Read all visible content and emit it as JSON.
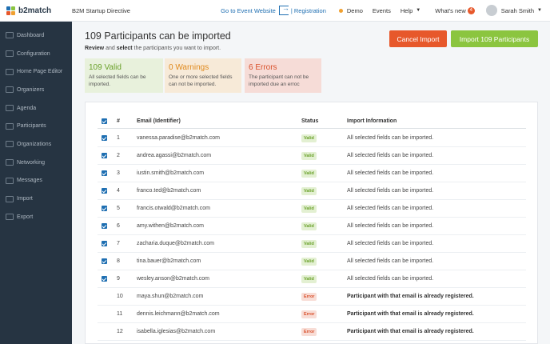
{
  "topbar": {
    "brand": "b2match",
    "event": "B2M Startup Directive",
    "links": {
      "event_website": "Go to Event Website",
      "registration": "| Registration",
      "demo": "Demo",
      "events": "Events",
      "help": "Help",
      "whats_new": "What's new",
      "whats_new_count": "4",
      "user": "Sarah Smith"
    },
    "colors": {
      "brand_blue": "#1f6fb2",
      "brand_green": "#8bc53f",
      "brand_orange": "#e7582b"
    }
  },
  "sidebar": {
    "items": [
      {
        "label": "Dashboard",
        "icon": "dashboard-icon"
      },
      {
        "label": "Configuration",
        "icon": "configuration-icon"
      },
      {
        "label": "Home Page Editor",
        "icon": "home-editor-icon"
      },
      {
        "label": "Organizers",
        "icon": "organizers-icon"
      },
      {
        "label": "Agenda",
        "icon": "agenda-icon"
      },
      {
        "label": "Participants",
        "icon": "participants-icon"
      },
      {
        "label": "Organizations",
        "icon": "organizations-icon"
      },
      {
        "label": "Networking",
        "icon": "networking-icon"
      },
      {
        "label": "Messages",
        "icon": "messages-icon"
      },
      {
        "label": "Import",
        "icon": "import-icon"
      },
      {
        "label": "Export",
        "icon": "export-icon"
      }
    ]
  },
  "main": {
    "title": "109 Participants can be imported",
    "subtitle_1": "Review",
    "subtitle_2": " and ",
    "subtitle_3": "select",
    "subtitle_4": " the participants you want to import.",
    "cancel_label": "Cancel Import",
    "import_label": "Import 109 Participants",
    "stats": {
      "valid": {
        "title": "109 Valid",
        "desc": "All selected fields can be imported."
      },
      "warnings": {
        "title": "0 Warnings",
        "desc": "One or more selected fields can not be imported."
      },
      "errors": {
        "title": "6 Errors",
        "desc": "The participant can not be imported due an erroc"
      }
    }
  },
  "table": {
    "headers": {
      "num": "#",
      "email": "Email (Identifier)",
      "status": "Status",
      "info": "Import Information"
    },
    "rows": [
      {
        "checked": true,
        "num": "1",
        "email": "vanessa.paradise@b2match.com",
        "status": "Valid",
        "info": "All selected fields can be imported."
      },
      {
        "checked": true,
        "num": "2",
        "email": "andrea.agassi@b2match.com",
        "status": "Valid",
        "info": "All selected fields can be imported."
      },
      {
        "checked": true,
        "num": "3",
        "email": "iustin.smith@b2match.com",
        "status": "Valid",
        "info": "All selected fields can be imported."
      },
      {
        "checked": true,
        "num": "4",
        "email": "franco.ted@b2match.com",
        "status": "Valid",
        "info": "All selected fields can be imported."
      },
      {
        "checked": true,
        "num": "5",
        "email": "francis.otwald@b2match.com",
        "status": "Valid",
        "info": "All selected fields can be imported."
      },
      {
        "checked": true,
        "num": "6",
        "email": "amy.withen@b2match.com",
        "status": "Valid",
        "info": "All selected fields can be imported."
      },
      {
        "checked": true,
        "num": "7",
        "email": "zacharia.duque@b2match.com",
        "status": "Valid",
        "info": "All selected fields can be imported."
      },
      {
        "checked": true,
        "num": "8",
        "email": "tina.bauer@b2match.com",
        "status": "Valid",
        "info": "All selected fields can be imported."
      },
      {
        "checked": true,
        "num": "9",
        "email": "wesley.anson@b2match.com",
        "status": "Valid",
        "info": "All selected fields can be imported."
      },
      {
        "checked": false,
        "num": "10",
        "email": "maya.shun@b2match.com",
        "status": "Error",
        "info": "Participant with that email is already registered."
      },
      {
        "checked": false,
        "num": "11",
        "email": "dennis.leichmann@b2match.com",
        "status": "Error",
        "info": "Participant with that email is already registered."
      },
      {
        "checked": false,
        "num": "12",
        "email": "isabella.iglesias@b2match.com",
        "status": "Error",
        "info": "Participant with that email is already registered."
      }
    ]
  }
}
